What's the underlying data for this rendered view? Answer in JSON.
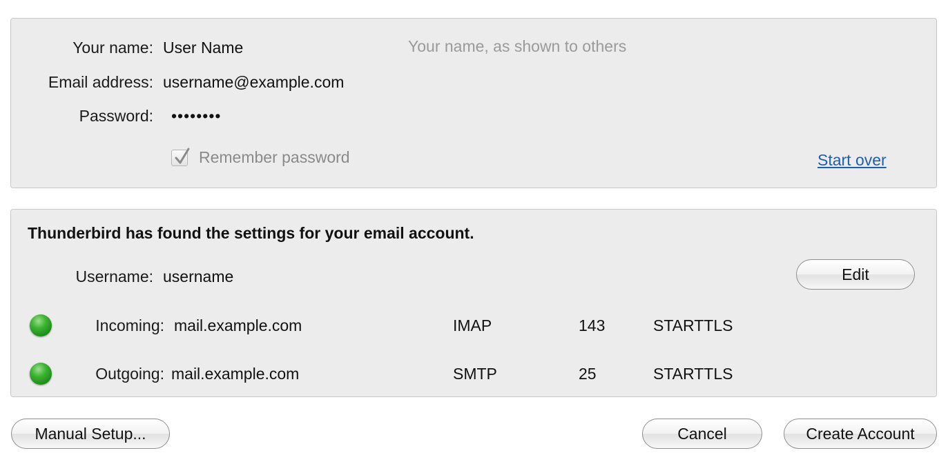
{
  "account": {
    "name_label": "Your name:",
    "name_value": "User Name",
    "name_hint": "Your name, as shown to others",
    "email_label": "Email address:",
    "email_value": "username@example.com",
    "password_label": "Password:",
    "password_value": "••••••••",
    "remember_label": "Remember password",
    "remember_checked": true,
    "start_over_label": "Start over"
  },
  "settings": {
    "heading": "Thunderbird has found the settings for your email account.",
    "username_label": "Username:",
    "username_value": "username",
    "edit_label": "Edit",
    "incoming": {
      "label": "Incoming:",
      "server": "mail.example.com",
      "protocol": "IMAP",
      "port": "143",
      "security": "STARTTLS",
      "status_color": "#2fa82a"
    },
    "outgoing": {
      "label": "Outgoing:",
      "server": "mail.example.com",
      "protocol": "SMTP",
      "port": "25",
      "security": "STARTTLS",
      "status_color": "#2fa82a"
    }
  },
  "footer": {
    "manual_setup_label": "Manual Setup...",
    "cancel_label": "Cancel",
    "create_account_label": "Create Account"
  }
}
